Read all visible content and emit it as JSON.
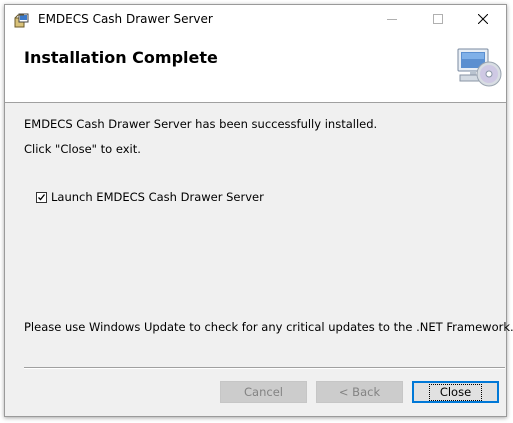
{
  "window": {
    "title": "EMDECS Cash Drawer Server",
    "controls": {
      "minimize": "minimize",
      "maximize": "maximize",
      "close": "close"
    }
  },
  "header": {
    "title": "Installation Complete",
    "graphic_icon": "computer-with-cd-icon"
  },
  "body": {
    "message_installed": "EMDECS Cash Drawer Server has been successfully installed.",
    "message_close": "Click \"Close\" to exit.",
    "launch_checkbox": {
      "label": "Launch EMDECS Cash Drawer Server",
      "checked": true
    },
    "update_notice": "Please use Windows Update to check for any critical updates to the .NET Framework."
  },
  "buttons": {
    "cancel": {
      "label": "Cancel",
      "enabled": false
    },
    "back": {
      "label": "< Back",
      "enabled": false
    },
    "close": {
      "label": "Close",
      "enabled": true,
      "default": true
    }
  },
  "colors": {
    "accent": "#0078d7",
    "dialog_background": "#f0f0f0",
    "disabled_text": "#838383"
  }
}
